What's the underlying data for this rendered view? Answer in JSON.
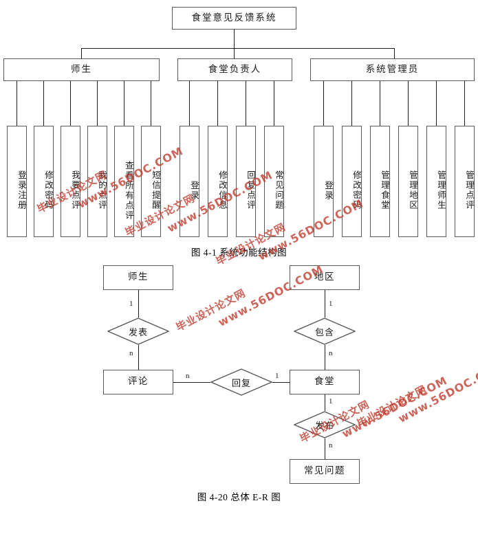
{
  "figure1": {
    "caption": "图 4-1  系统功能结构图",
    "root": {
      "label": "食堂意见反馈系统"
    },
    "groups": [
      {
        "label": "师生",
        "leaves": [
          {
            "label": "登录注册"
          },
          {
            "label": "修改密码"
          },
          {
            "label": "我要点评"
          },
          {
            "label": "我的点评"
          },
          {
            "label": "查看所有点评"
          },
          {
            "label": "短信提醒"
          }
        ]
      },
      {
        "label": "食堂负责人",
        "leaves": [
          {
            "label": "登录"
          },
          {
            "label": "修改信息"
          },
          {
            "label": "回复点评"
          },
          {
            "label": "常见问题"
          }
        ]
      },
      {
        "label": "系统管理员",
        "leaves": [
          {
            "label": "登录"
          },
          {
            "label": "修改密码"
          },
          {
            "label": "管理食堂"
          },
          {
            "label": "管理地区"
          },
          {
            "label": "管理师生"
          },
          {
            "label": "管理点评"
          }
        ]
      }
    ]
  },
  "figure2": {
    "caption": "图 4-20  总体 E-R 图",
    "entities": [
      {
        "id": "teacher_student",
        "label": "师生"
      },
      {
        "id": "region",
        "label": "地区"
      },
      {
        "id": "comment",
        "label": "评论"
      },
      {
        "id": "canteen",
        "label": "食堂"
      },
      {
        "id": "faq",
        "label": "常见问题"
      }
    ],
    "relationships": [
      {
        "id": "publish_comment",
        "label": "发表",
        "from": "师生",
        "to": "评论",
        "from_card": "1",
        "to_card": "n"
      },
      {
        "id": "contains",
        "label": "包含",
        "from": "地区",
        "to": "食堂",
        "from_card": "1",
        "to_card": "n"
      },
      {
        "id": "reply",
        "label": "回复",
        "from": "评论",
        "to": "食堂",
        "from_card": "n",
        "to_card": "1"
      },
      {
        "id": "publish_faq",
        "label": "发布",
        "from": "食堂",
        "to": "常见问题",
        "from_card": "1",
        "to_card": "n"
      }
    ]
  },
  "watermark": {
    "chinese": "毕业设计论文网",
    "english": "www.56DOC.COM",
    "color": "#c0392b"
  }
}
